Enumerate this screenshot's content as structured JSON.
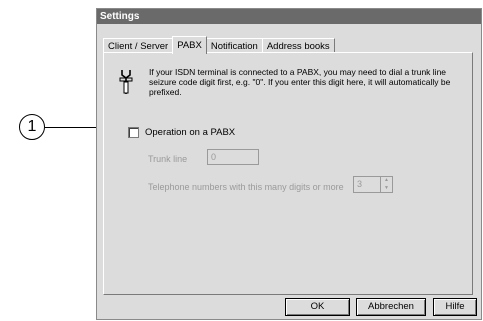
{
  "callout": {
    "number": "1"
  },
  "window": {
    "title": "Settings"
  },
  "tabs": [
    {
      "label": "Client / Server"
    },
    {
      "label": "PABX"
    },
    {
      "label": "Notification"
    },
    {
      "label": "Address books"
    }
  ],
  "active_tab": "PABX",
  "info": {
    "icon": "wrench-icon",
    "text": "If your ISDN terminal is connected to a PABX, you may need to dial a trunk line seizure code digit first, e.g. \"0\". If you enter this digit here, it will automatically be prefixed."
  },
  "pabx_option": {
    "label": "Operation on a PABX",
    "checked": false
  },
  "trunk_line": {
    "label": "Trunk line",
    "value": "0"
  },
  "digits": {
    "label": "Telephone numbers with this many digits or more",
    "value": "3"
  },
  "buttons": {
    "ok": "OK",
    "cancel": "Abbrechen",
    "help": "Hilfe"
  }
}
